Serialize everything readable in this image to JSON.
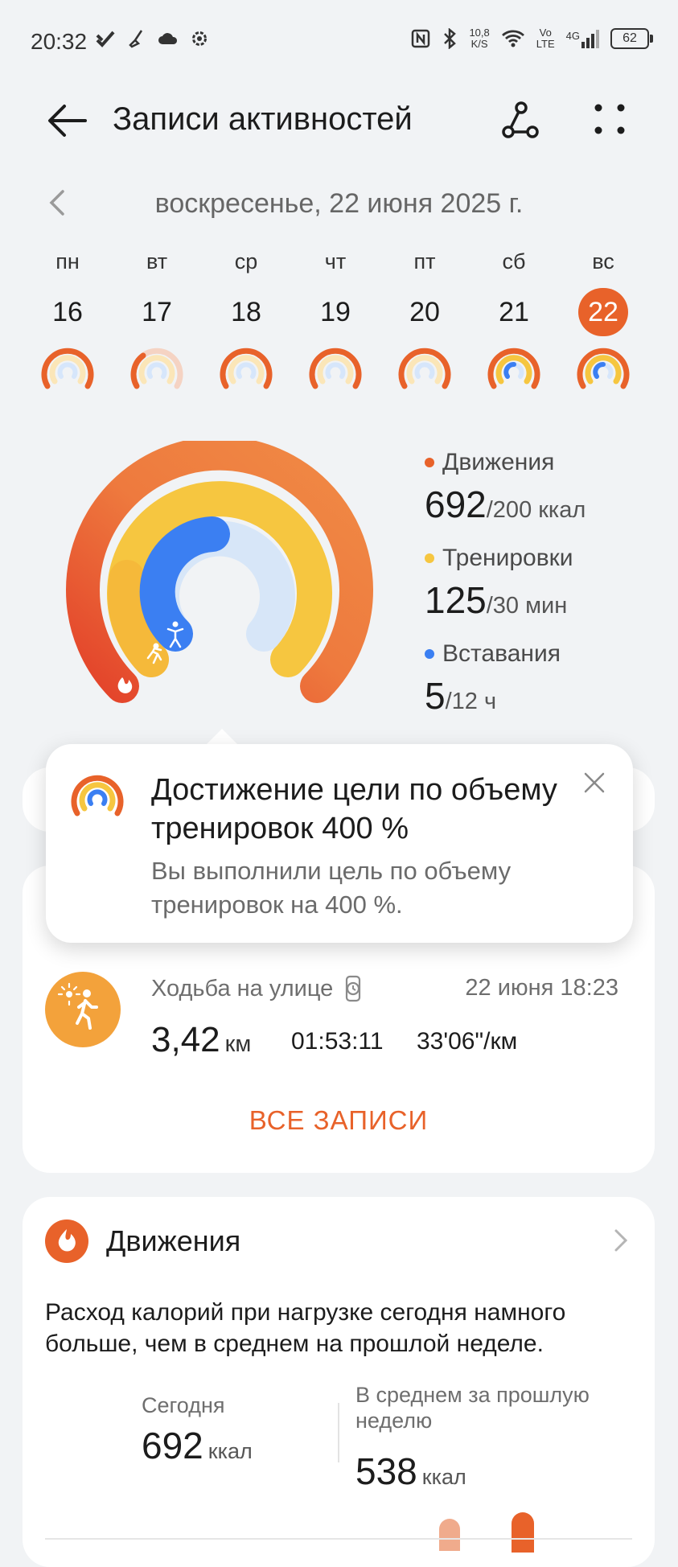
{
  "status_bar": {
    "time": "20:32",
    "net_speed_value": "10,8",
    "net_speed_unit": "K/S",
    "volte_top": "Vo",
    "volte_bottom": "LTE",
    "network": "4G",
    "battery": "62",
    "left_icons": [
      "tick-icon",
      "broom-icon",
      "cloud-icon",
      "gear-icon"
    ],
    "right_icons": [
      "nfc-icon",
      "bluetooth-icon",
      "wifi-icon",
      "signal-icon",
      "battery-icon"
    ]
  },
  "app_bar": {
    "title": "Записи активностей",
    "actions": [
      "back-arrow-icon",
      "route-share-icon",
      "more-grid-icon"
    ]
  },
  "date_nav": {
    "label": "воскресенье, 22 июня 2025 г."
  },
  "week": [
    {
      "dow": "пн",
      "day": "16",
      "selected": false
    },
    {
      "dow": "вт",
      "day": "17",
      "selected": false
    },
    {
      "dow": "ср",
      "day": "18",
      "selected": false
    },
    {
      "dow": "чт",
      "day": "19",
      "selected": false
    },
    {
      "dow": "пт",
      "day": "20",
      "selected": false
    },
    {
      "dow": "сб",
      "day": "21",
      "selected": false
    },
    {
      "dow": "вс",
      "day": "22",
      "selected": true
    }
  ],
  "rings": {
    "colors": {
      "move": "#e8622a",
      "exercise": "#f6c640",
      "stand": "#3b7ff2",
      "accent": "#e8622a"
    },
    "move": {
      "label": "Движения",
      "value": "692",
      "goal": "/200 ккал",
      "progress": 3.46
    },
    "exercise": {
      "label": "Тренировки",
      "value": "125",
      "goal": "/30 мин",
      "progress": 4.17
    },
    "stand": {
      "label": "Вставания",
      "value": "5",
      "goal": "/12 ч",
      "progress": 0.42
    }
  },
  "popover": {
    "title": "Достижение цели по объему тренировок 400 %",
    "text": "Вы выполнили цель по объему тренировок на 400 %."
  },
  "record": {
    "type": "Ходьба на улице",
    "datetime": "22 июня 18:23",
    "distance": "3,42",
    "distance_unit": "км",
    "duration": "01:53:11",
    "pace": "33'06\"/км",
    "all_label": "ВСЕ ЗАПИСИ"
  },
  "movement_card": {
    "title": "Движения",
    "text": "Расход калорий при нагрузке сегодня намного больше, чем в среднем на прошлой неделе.",
    "today_label": "Сегодня",
    "today_value": "692",
    "today_unit": "ккал",
    "avg_label": "В среднем за прошлую неделю",
    "avg_value": "538",
    "avg_unit": "ккал"
  }
}
